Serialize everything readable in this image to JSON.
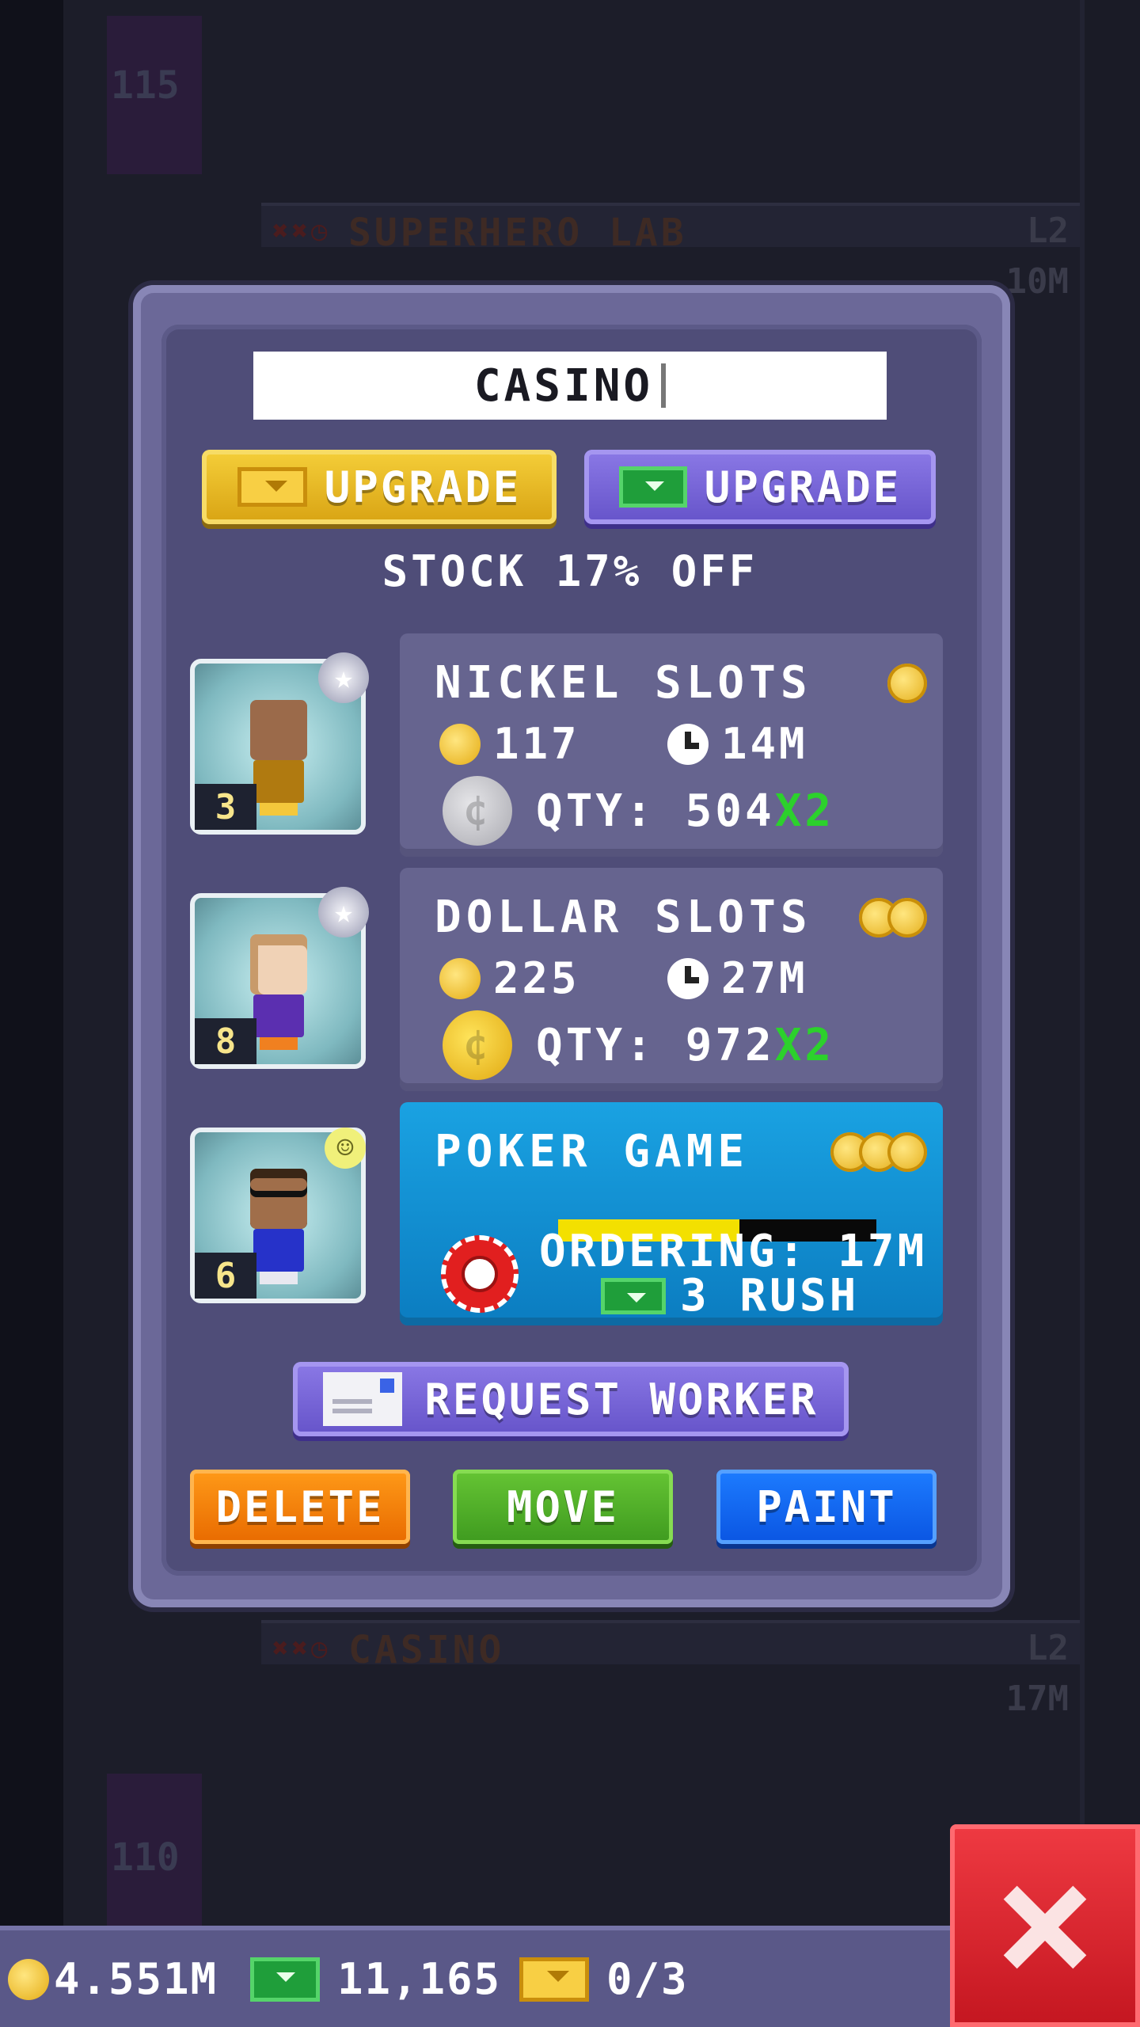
{
  "background": {
    "floor_numbers": [
      "115",
      "110"
    ],
    "floors": [
      {
        "name": "SUPERHERO LAB",
        "level": "L2",
        "sub": "10M"
      },
      {
        "name": "CASINO",
        "level": "L2",
        "sub": "17M"
      }
    ]
  },
  "dialog": {
    "floor_name": "CASINO",
    "upgrade_ticket_label": "UPGRADE",
    "upgrade_bux_label": "UPGRADE",
    "stock_message": "STOCK 17% OFF",
    "workers": [
      {
        "level": "3",
        "badge": "star",
        "skin": "#9b6a4a",
        "shirt": "#b07a10"
      },
      {
        "level": "8",
        "badge": "star",
        "skin": "#f0d2b6",
        "shirt": "#5b2fb0"
      },
      {
        "level": "6",
        "badge": "smiley",
        "skin": "#a06e4a",
        "shirt": "#2632c9"
      }
    ],
    "products": [
      {
        "name": "NICKEL SLOTS",
        "price": "117",
        "time": "14M",
        "qty_label": "QTY: 504",
        "multiplier": "X2",
        "tier": 1
      },
      {
        "name": "DOLLAR SLOTS",
        "price": "225",
        "time": "27M",
        "qty_label": "QTY: 972",
        "multiplier": "X2",
        "tier": 2
      },
      {
        "name": "POKER GAME",
        "ordering": "ORDERING: 17M",
        "rush": "3 RUSH",
        "progress": 0.57,
        "tier": 3
      }
    ],
    "request_worker_label": "REQUEST WORKER",
    "delete_label": "DELETE",
    "move_label": "MOVE",
    "paint_label": "PAINT"
  },
  "bottom_bar": {
    "coins": "4.551M",
    "bux": "11,165",
    "tickets": "0/3"
  },
  "icons": {
    "close": "close-x-icon",
    "coin": "coin-icon",
    "bux": "bux-icon",
    "ticket": "golden-ticket-icon",
    "clock": "clock-icon"
  }
}
